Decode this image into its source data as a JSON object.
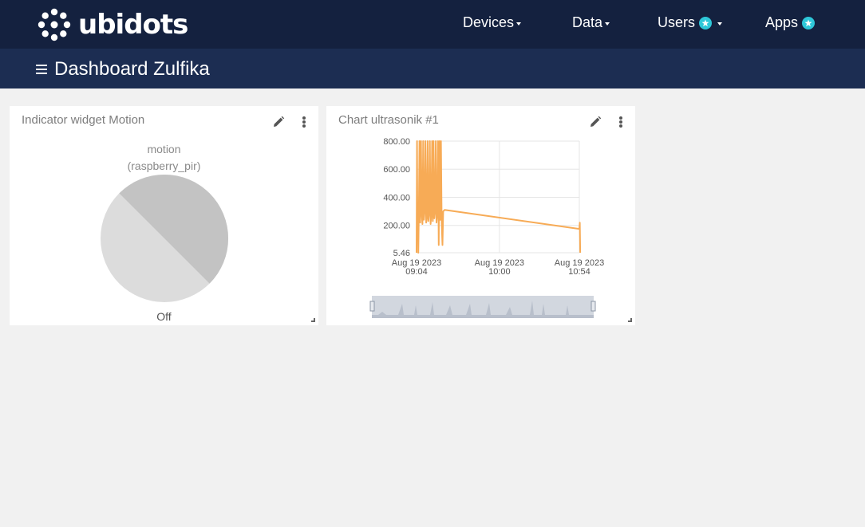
{
  "app": {
    "logo_text": "ubidots"
  },
  "nav": {
    "devices": "Devices",
    "data": "Data",
    "users": "Users",
    "apps": "Apps"
  },
  "dashboard": {
    "title": "Dashboard Zulfika"
  },
  "indicator_widget": {
    "title": "Indicator widget Motion",
    "variable": "motion",
    "device": "(raspberry_pir)",
    "state": "Off"
  },
  "chart_widget": {
    "title": "Chart ultrasonik #1"
  },
  "colors": {
    "topbar": "#14213f",
    "subbar": "#1c2d52",
    "badge": "#2ec7d9",
    "series": "#f7ab56"
  },
  "chart_data": {
    "type": "line",
    "title": "Chart ultrasonik #1",
    "xlabel": "",
    "ylabel": "",
    "y_ticks": [
      "800.00",
      "600.00",
      "400.00",
      "200.00",
      "5.46"
    ],
    "x_ticks": [
      {
        "line1": "Aug 19 2023",
        "line2": "09:04"
      },
      {
        "line1": "Aug 19 2023",
        "line2": "10:00"
      },
      {
        "line1": "Aug 19 2023",
        "line2": "10:54"
      }
    ],
    "ylim": [
      5.46,
      800
    ],
    "xlim_minutes": [
      0,
      110
    ],
    "series": [
      {
        "values": [
          [
            0,
            5.46
          ],
          [
            0.3,
            800
          ],
          [
            0.6,
            230
          ],
          [
            0.9,
            300
          ],
          [
            1.2,
            5.46
          ],
          [
            1.5,
            250
          ],
          [
            2,
            800
          ],
          [
            2.5,
            220
          ],
          [
            3,
            800
          ],
          [
            3.5,
            280
          ],
          [
            4,
            210
          ],
          [
            4.5,
            800
          ],
          [
            5,
            240
          ],
          [
            5.5,
            300
          ],
          [
            6,
            800
          ],
          [
            6.5,
            220
          ],
          [
            7,
            260
          ],
          [
            7.5,
            800
          ],
          [
            8,
            230
          ],
          [
            8.5,
            290
          ],
          [
            9,
            800
          ],
          [
            9.5,
            210
          ],
          [
            10,
            270
          ],
          [
            10.5,
            800
          ],
          [
            11,
            230
          ],
          [
            11.5,
            800
          ],
          [
            12,
            250
          ],
          [
            12.5,
            300
          ],
          [
            13,
            800
          ],
          [
            13.5,
            220
          ],
          [
            14,
            280
          ],
          [
            14.5,
            800
          ],
          [
            15,
            60
          ],
          [
            15.5,
            800
          ],
          [
            16,
            240
          ],
          [
            16.5,
            800
          ],
          [
            17,
            220
          ],
          [
            17.5,
            60
          ],
          [
            18,
            300
          ],
          [
            19,
            310
          ],
          [
            110,
            175
          ],
          [
            110.3,
            220
          ],
          [
            110.6,
            5.46
          ]
        ]
      }
    ]
  }
}
